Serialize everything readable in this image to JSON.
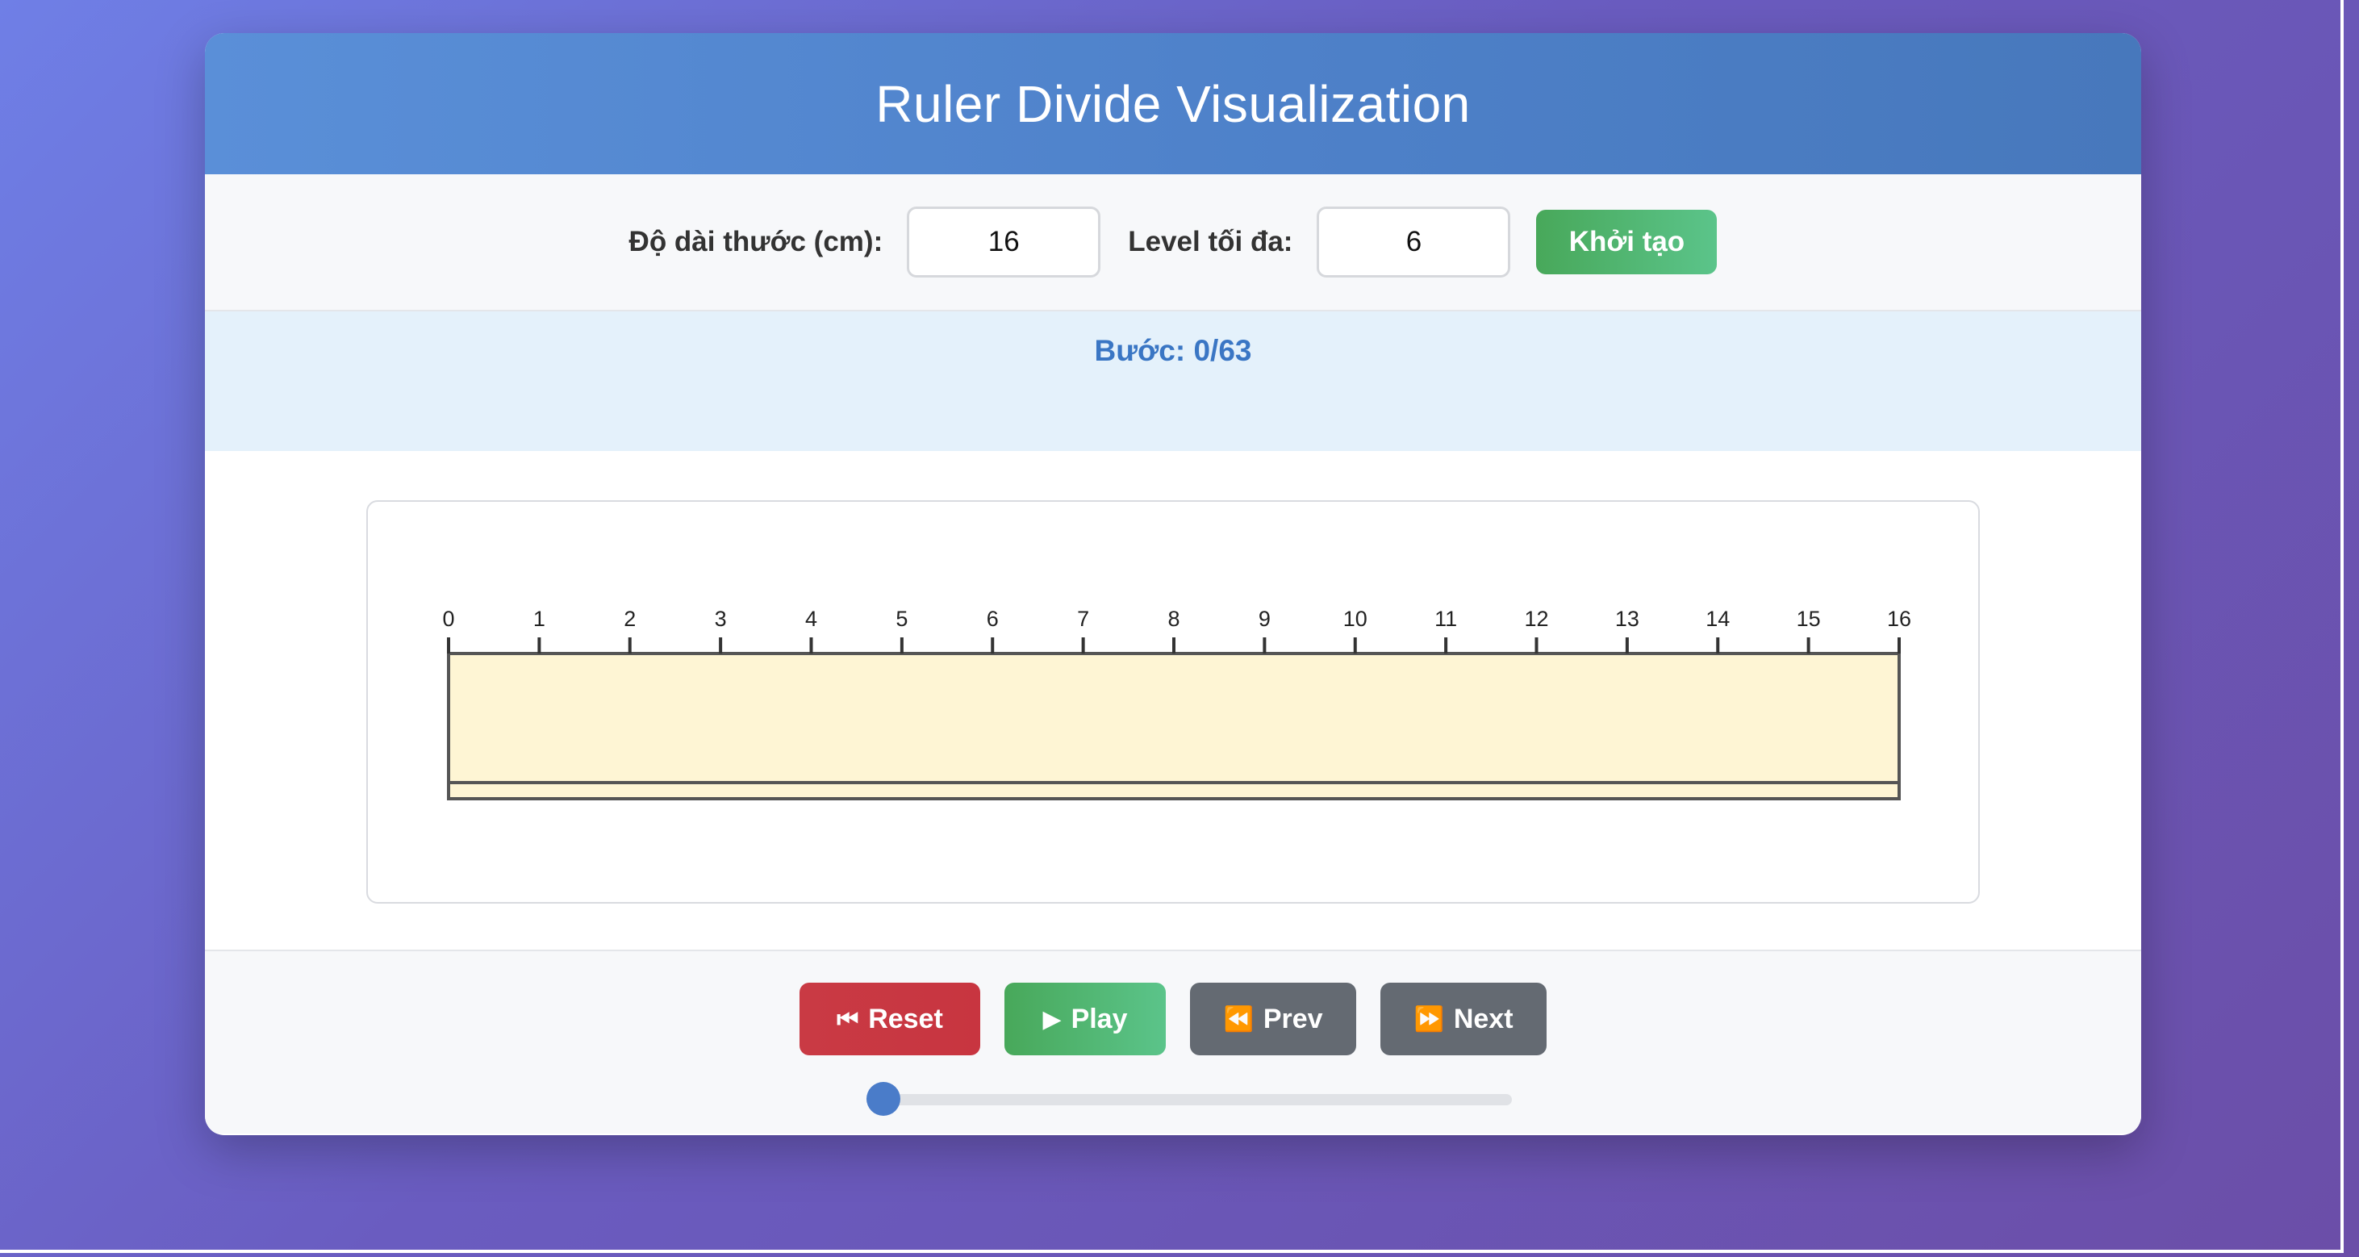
{
  "app": {
    "title": "Ruler Divide Visualization"
  },
  "controls": {
    "length_label": "Độ dài thước (cm):",
    "length_value": "16",
    "level_label": "Level tối đa:",
    "level_value": "6",
    "init_button": "Khởi tạo"
  },
  "status": {
    "step_text": "Bước: 0/63",
    "step_current": 0,
    "step_total": 63
  },
  "ruler": {
    "length": 16,
    "ticks": [
      "0",
      "1",
      "2",
      "3",
      "4",
      "5",
      "6",
      "7",
      "8",
      "9",
      "10",
      "11",
      "12",
      "13",
      "14",
      "15",
      "16"
    ],
    "fill_color": "#fef5d4",
    "stroke_color": "#555555"
  },
  "playback": {
    "reset_label": "Reset",
    "reset_icon": "skip-back-icon",
    "play_label": "Play",
    "play_icon": "play-icon",
    "prev_label": "Prev",
    "prev_icon": "rewind-icon",
    "next_label": "Next",
    "next_icon": "fast-forward-icon",
    "progress": 0
  }
}
